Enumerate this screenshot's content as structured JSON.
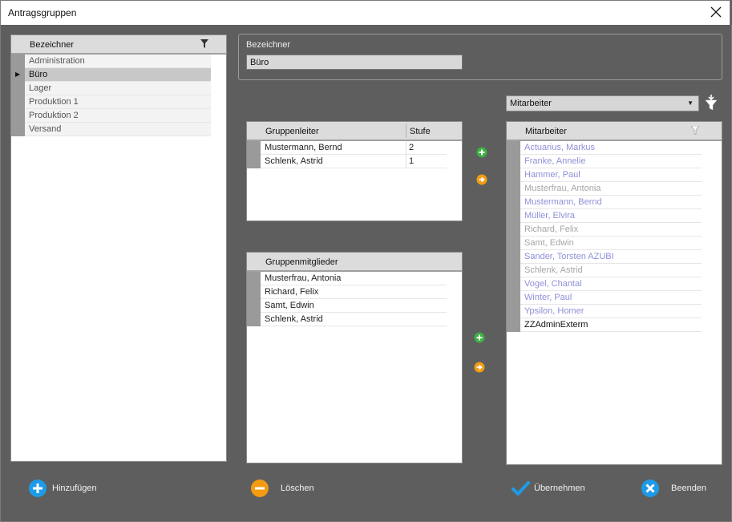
{
  "window": {
    "title": "Antragsgruppen"
  },
  "left_grid": {
    "header": "Bezeichner",
    "rows": [
      "Administration",
      "Büro",
      "Lager",
      "Produktion 1",
      "Produktion 2",
      "Versand"
    ],
    "selected_index": 1
  },
  "detail": {
    "label": "Bezeichner",
    "value": "Büro"
  },
  "employee_filter": {
    "selected": "Mitarbeiter"
  },
  "leaders_grid": {
    "headers": [
      "Gruppenleiter",
      "Stufe"
    ],
    "rows": [
      {
        "name": "Mustermann, Bernd",
        "level": "2"
      },
      {
        "name": "Schlenk, Astrid",
        "level": "1"
      }
    ]
  },
  "members_grid": {
    "header": "Gruppenmitglieder",
    "rows": [
      "Musterfrau, Antonia",
      "Richard, Felix",
      "Samt, Edwin",
      "Schlenk, Astrid"
    ]
  },
  "employees_grid": {
    "header": "Mitarbeiter",
    "rows": [
      {
        "name": "Actuarius, Markus",
        "tone": "blue"
      },
      {
        "name": "Franke, Annelie",
        "tone": "blue"
      },
      {
        "name": "Hammer, Paul",
        "tone": "blue"
      },
      {
        "name": "Musterfrau, Antonia",
        "tone": "gray"
      },
      {
        "name": "Mustermann, Bernd",
        "tone": "blue"
      },
      {
        "name": "Müller, Elvira",
        "tone": "blue"
      },
      {
        "name": "Richard, Felix",
        "tone": "gray"
      },
      {
        "name": "Samt, Edwin",
        "tone": "gray"
      },
      {
        "name": "Sander, Torsten AZUBI",
        "tone": "blue"
      },
      {
        "name": "Schlenk, Astrid",
        "tone": "gray"
      },
      {
        "name": "Vogel, Chantal",
        "tone": "blue"
      },
      {
        "name": "Winter, Paul",
        "tone": "blue"
      },
      {
        "name": "Ypsilon, Homer",
        "tone": "blue"
      },
      {
        "name": "ZZAdminExterm",
        "tone": "black"
      }
    ]
  },
  "buttons": {
    "add": "Hinzufügen",
    "delete": "Löschen",
    "apply": "Übernehmen",
    "close": "Beenden"
  },
  "colors": {
    "add_icon": "#1e9be8",
    "delete_icon": "#f39c12",
    "apply_icon": "#1e9be8",
    "close_icon": "#1e9be8",
    "move_add": "#3cb043",
    "move_arrow": "#f39c12",
    "employee_blue": "#8f8fd8",
    "employee_gray": "#a6a6a6"
  },
  "icons": {
    "close": "close-icon",
    "filter": "filter-icon",
    "funnel_clear": "funnel-icon",
    "add_to_leaders": "plus-circle-icon",
    "remove_from_leaders": "arrow-right-circle-icon",
    "add_to_members": "plus-circle-icon",
    "remove_from_members": "arrow-right-circle-icon"
  }
}
